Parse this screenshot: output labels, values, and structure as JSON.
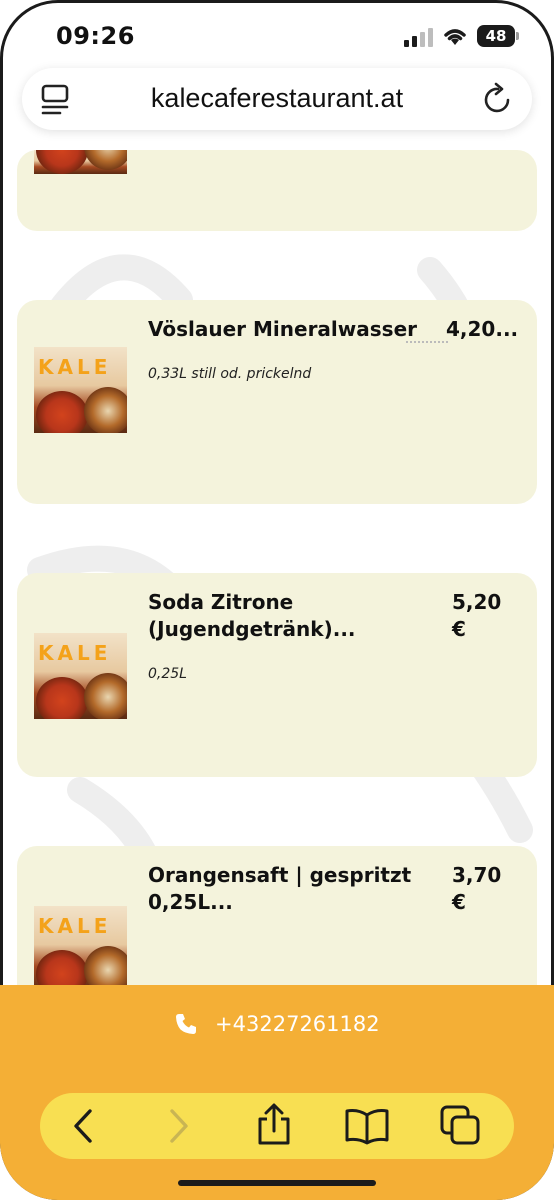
{
  "status_bar": {
    "time": "09:26",
    "battery": "48"
  },
  "url_bar": {
    "domain": "kalecaferestaurant.at"
  },
  "thumbnail": {
    "logo_text": "KALE"
  },
  "menu_items": [
    {
      "title": "Vöslauer Mineralwasser",
      "price": "4,20...",
      "description": "0,33L  still od. prickelnd"
    },
    {
      "title": "Soda Zitrone (Jugendgetränk)...",
      "price": "5,20 €",
      "description": "0,25L"
    },
    {
      "title": "Orangensaft | gespritzt 0,25L...",
      "price": "3,70 €",
      "description": ""
    }
  ],
  "contact": {
    "phone": "+43227261182"
  },
  "colors": {
    "card": "#f4f3dc",
    "accent": "#f4af36",
    "toolbar": "#f8df52"
  },
  "toolbar": {
    "icons": [
      "back-icon",
      "forward-icon",
      "share-icon",
      "bookmarks-icon",
      "tabs-icon"
    ]
  }
}
